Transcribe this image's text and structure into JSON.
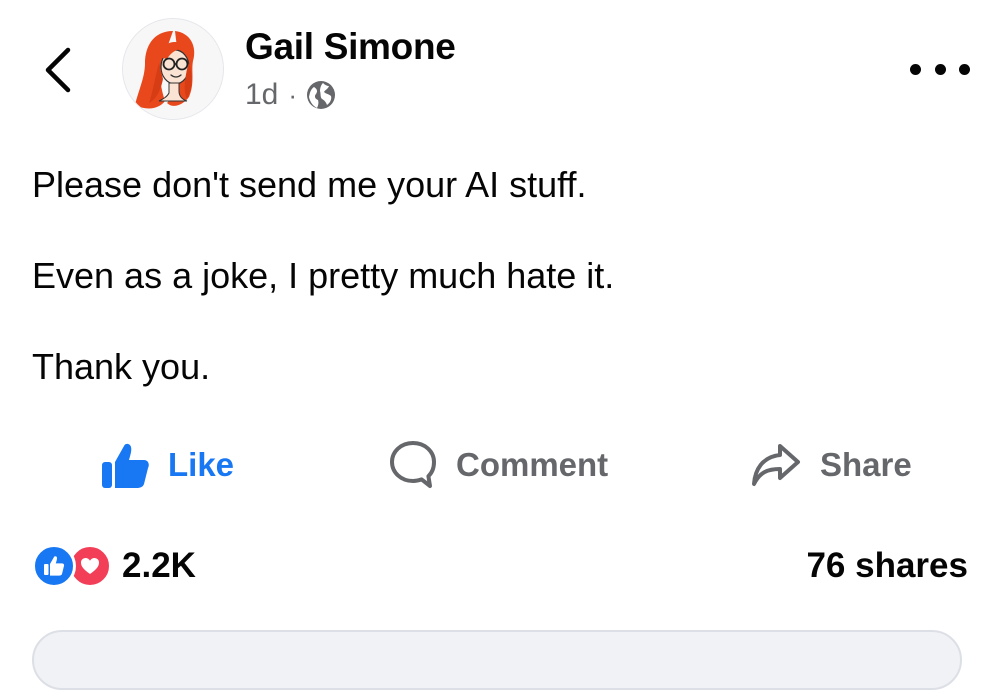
{
  "post": {
    "author": "Gail Simone",
    "timestamp": "1d",
    "separator": "·",
    "privacy_icon": "globe-icon",
    "paragraphs": [
      "Please don't send me your AI stuff.",
      "Even as a joke, I pretty much hate it.",
      "Thank you."
    ]
  },
  "actions": {
    "like_label": "Like",
    "comment_label": "Comment",
    "share_label": "Share"
  },
  "stats": {
    "reaction_count": "2.2K",
    "shares": "76 shares"
  },
  "icons": {
    "back": "chevron-left-icon",
    "more": "more-horizontal-icon",
    "like": "thumbs-up-icon",
    "comment": "speech-bubble-icon",
    "share": "share-arrow-icon"
  },
  "colors": {
    "accent": "#1877f2",
    "muted": "#65676b",
    "love": "#f33e58"
  }
}
